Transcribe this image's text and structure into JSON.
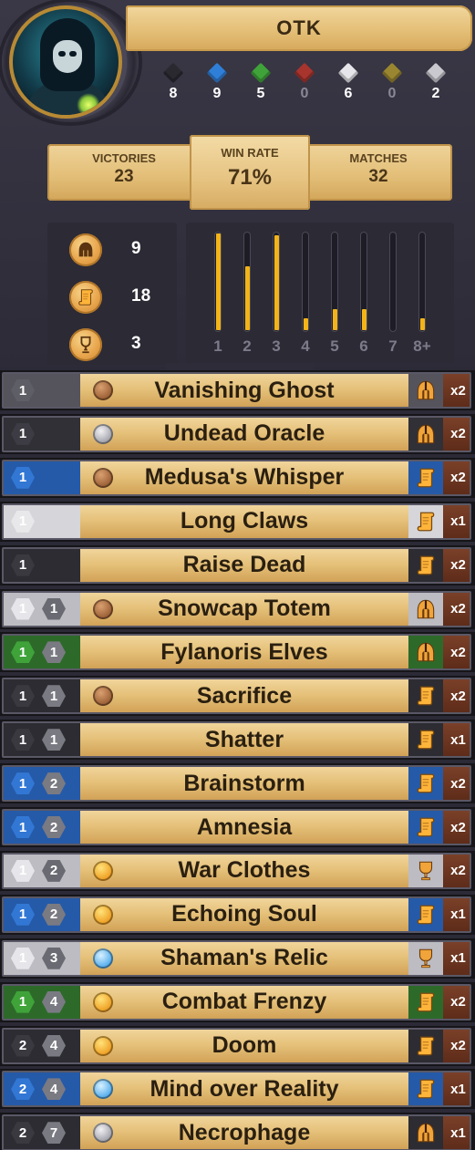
{
  "profile": {
    "name": "OTK",
    "avatar_icon": "hooded-skeleton-mage-icon"
  },
  "gem_counts": [
    {
      "icon": "shadow-gem-icon",
      "color": "#2a2930",
      "count": "8"
    },
    {
      "icon": "blue-gem-icon",
      "color": "#2f7fd9",
      "count": "9"
    },
    {
      "icon": "green-gem-icon",
      "color": "#3fa33a",
      "count": "5"
    },
    {
      "icon": "red-gem-icon",
      "color": "#a8342e",
      "count": "0"
    },
    {
      "icon": "white-gem-icon",
      "color": "#e6e6ea",
      "count": "6"
    },
    {
      "icon": "gold-gem-icon",
      "color": "#9a8630",
      "count": "0"
    },
    {
      "icon": "neutral-gem-icon",
      "color": "#c9c9cf",
      "count": "2"
    }
  ],
  "stats": {
    "victories_label": "VICTORIES",
    "victories": "23",
    "winrate_label": "WIN RATE",
    "winrate": "71%",
    "matches_label": "MATCHES",
    "matches": "32"
  },
  "rarity": [
    {
      "icon": "helmet-icon",
      "count": "9"
    },
    {
      "icon": "scroll-icon",
      "count": "18"
    },
    {
      "icon": "trophy-icon",
      "count": "3"
    }
  ],
  "curve": {
    "accent": "#f2b418",
    "ticks": [
      "1",
      "2",
      "3",
      "4",
      "5",
      "6",
      "7",
      "8+"
    ],
    "levels": [
      1.0,
      0.66,
      0.98,
      0.12,
      0.22,
      0.22,
      0.0,
      0.12
    ]
  },
  "deck": [
    {
      "name": "Vanishing Ghost",
      "gems": [
        {
          "v": "1",
          "c": "#5e5e66"
        }
      ],
      "bg": "#55545c",
      "set": "bronze",
      "rarity": "helmet",
      "count": "x2"
    },
    {
      "name": "Undead Oracle",
      "gems": [
        {
          "v": "1",
          "c": "#3d3c44"
        }
      ],
      "bg": "#303036",
      "set": "silver",
      "rarity": "helmet",
      "count": "x2"
    },
    {
      "name": "Medusa's Whisper",
      "gems": [
        {
          "v": "1",
          "c": "#3277d4"
        }
      ],
      "bg": "#255aa8",
      "set": "bronze",
      "rarity": "scroll",
      "count": "x2"
    },
    {
      "name": "Long Claws",
      "gems": [
        {
          "v": "1",
          "c": "#e8e8ea"
        }
      ],
      "bg": "#d6d6da",
      "set": "none",
      "rarity": "scroll",
      "count": "x1"
    },
    {
      "name": "Raise Dead",
      "gems": [
        {
          "v": "1",
          "c": "#3a3940"
        }
      ],
      "bg": "#2c2c32",
      "set": "none",
      "rarity": "scroll",
      "count": "x2"
    },
    {
      "name": "Snowcap Totem",
      "gems": [
        {
          "v": "1",
          "c": "#e6e6ea"
        },
        {
          "v": "1",
          "c": "#6a6a72"
        }
      ],
      "bg": "#bcbcc2",
      "set": "bronze",
      "rarity": "helmet",
      "count": "x2"
    },
    {
      "name": "Fylanoris Elves",
      "gems": [
        {
          "v": "1",
          "c": "#3fa33a"
        },
        {
          "v": "1",
          "c": "#7a7a82"
        }
      ],
      "bg": "#2d6a2a",
      "set": "none",
      "rarity": "helmet",
      "count": "x2"
    },
    {
      "name": "Sacrifice",
      "gems": [
        {
          "v": "1",
          "c": "#3a3940"
        },
        {
          "v": "1",
          "c": "#7a7a82"
        }
      ],
      "bg": "#2c2c32",
      "set": "bronze",
      "rarity": "scroll",
      "count": "x2"
    },
    {
      "name": "Shatter",
      "gems": [
        {
          "v": "1",
          "c": "#3a3940"
        },
        {
          "v": "1",
          "c": "#7a7a82"
        }
      ],
      "bg": "#2c2c32",
      "set": "none",
      "rarity": "scroll",
      "count": "x1"
    },
    {
      "name": "Brainstorm",
      "gems": [
        {
          "v": "1",
          "c": "#3277d4"
        },
        {
          "v": "2",
          "c": "#7a7a82"
        }
      ],
      "bg": "#255aa8",
      "set": "none",
      "rarity": "scroll",
      "count": "x2"
    },
    {
      "name": "Amnesia",
      "gems": [
        {
          "v": "1",
          "c": "#3277d4"
        },
        {
          "v": "2",
          "c": "#7a7a82"
        }
      ],
      "bg": "#255aa8",
      "set": "none",
      "rarity": "scroll",
      "count": "x2"
    },
    {
      "name": "War Clothes",
      "gems": [
        {
          "v": "1",
          "c": "#e6e6ea"
        },
        {
          "v": "2",
          "c": "#6a6a72"
        }
      ],
      "bg": "#bcbcc2",
      "set": "gold",
      "rarity": "trophy",
      "count": "x2"
    },
    {
      "name": "Echoing Soul",
      "gems": [
        {
          "v": "1",
          "c": "#3277d4"
        },
        {
          "v": "2",
          "c": "#7a7a82"
        }
      ],
      "bg": "#255aa8",
      "set": "gold",
      "rarity": "scroll",
      "count": "x1"
    },
    {
      "name": "Shaman's Relic",
      "gems": [
        {
          "v": "1",
          "c": "#e6e6ea"
        },
        {
          "v": "3",
          "c": "#6a6a72"
        }
      ],
      "bg": "#bcbcc2",
      "set": "blue",
      "rarity": "trophy",
      "count": "x1"
    },
    {
      "name": "Combat Frenzy",
      "gems": [
        {
          "v": "1",
          "c": "#3fa33a"
        },
        {
          "v": "4",
          "c": "#7a7a82"
        }
      ],
      "bg": "#2d6a2a",
      "set": "gold",
      "rarity": "scroll",
      "count": "x2"
    },
    {
      "name": "Doom",
      "gems": [
        {
          "v": "2",
          "c": "#3a3940"
        },
        {
          "v": "4",
          "c": "#7a7a82"
        }
      ],
      "bg": "#2c2c32",
      "set": "gold",
      "rarity": "scroll",
      "count": "x2"
    },
    {
      "name": "Mind over Reality",
      "gems": [
        {
          "v": "2",
          "c": "#3277d4"
        },
        {
          "v": "4",
          "c": "#7a7a82"
        }
      ],
      "bg": "#255aa8",
      "set": "blue",
      "rarity": "scroll",
      "count": "x1"
    },
    {
      "name": "Necrophage",
      "gems": [
        {
          "v": "2",
          "c": "#3a3940"
        },
        {
          "v": "7",
          "c": "#7a7a82"
        }
      ],
      "bg": "#2c2c32",
      "set": "silver",
      "rarity": "helmet",
      "count": "x1"
    }
  ]
}
